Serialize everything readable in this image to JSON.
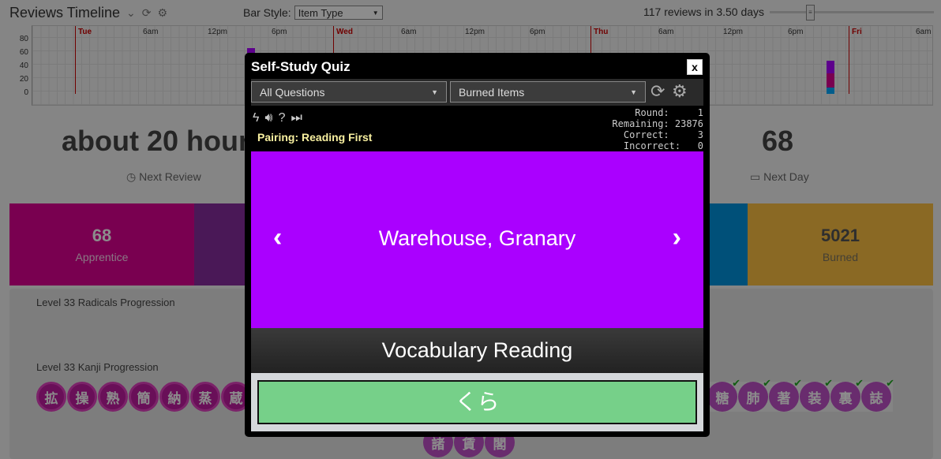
{
  "timeline": {
    "title": "Reviews Timeline",
    "bar_style_label": "Bar Style:",
    "bar_style_value": "Item Type",
    "summary": "117 reviews in 3.50 days",
    "y_ticks": [
      "80",
      "60",
      "40",
      "20",
      "0"
    ],
    "x_ticks": [
      "Tue",
      "6am",
      "12pm",
      "6pm",
      "Wed",
      "6am",
      "12pm",
      "6pm",
      "Thu",
      "6am",
      "12pm",
      "6pm",
      "Fri",
      "6am"
    ]
  },
  "stats": {
    "next_review_value": "about 20 hour",
    "next_review_label": "Next Review",
    "next_day_value": "68",
    "next_day_label": "Next Day"
  },
  "srs": {
    "apprentice_count": "68",
    "apprentice_label": "Apprentice",
    "burned_count": "5021",
    "burned_label": "Burned"
  },
  "progress": {
    "radicals_label": "Level 33 Radicals Progression",
    "kanji_label": "Level 33 Kanji Progression",
    "kanji_left": [
      "拡",
      "操",
      "熟",
      "簡",
      "納",
      "蒸",
      "蔵"
    ],
    "kanji_right": [
      "糖",
      "肺",
      "著",
      "装",
      "裏",
      "誌"
    ],
    "kanji_bottom": [
      "諸",
      "賃",
      "閣"
    ]
  },
  "quiz": {
    "title": "Self-Study Quiz",
    "close_label": "x",
    "question_filter": "All Questions",
    "item_source": "Burned Items",
    "pairing": "Pairing: Reading First",
    "stats_text": "Round:     1\nRemaining: 23876\nCorrect:     3\nIncorrect:   0",
    "prompt": "Warehouse, Granary",
    "question_type": "Vocabulary Reading",
    "answer": "くら",
    "card_color": "#aa00ff",
    "answer_color": "#76d089"
  }
}
